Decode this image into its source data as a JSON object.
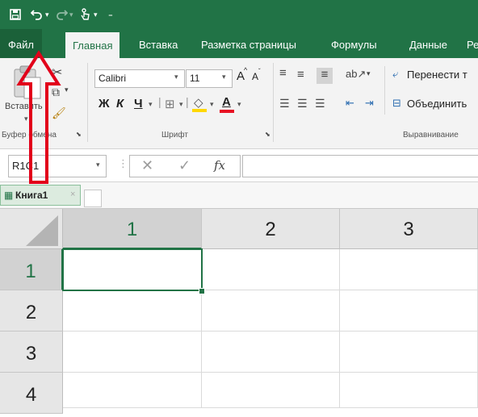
{
  "window": {
    "qat": {
      "save_icon": "save-icon",
      "undo_icon": "undo-icon",
      "redo_icon": "redo-icon",
      "touch_icon": "touch-mode-icon",
      "customize_icon": "customize-qat-icon"
    },
    "tabs": [
      {
        "label": "Файл"
      },
      {
        "label": "Главная"
      },
      {
        "label": "Вставка"
      },
      {
        "label": "Разметка страницы"
      },
      {
        "label": "Формулы"
      },
      {
        "label": "Данные"
      },
      {
        "label": "Ре"
      }
    ]
  },
  "ribbon": {
    "clipboard": {
      "paste_label": "Вставить",
      "group_label": "Буфер обмена"
    },
    "font": {
      "font_name": "Calibri",
      "font_size": "11",
      "grow_label": "A",
      "shrink_label": "A",
      "bold_label": "Ж",
      "italic_label": "К",
      "underline_label": "Ч",
      "fill_label": "",
      "color_label": "A",
      "group_label": "Шрифт"
    },
    "alignment": {
      "wrap_label": "Перенести т",
      "merge_label": "Объединить",
      "group_label": "Выравнивание"
    },
    "colors": {
      "accent": "#217346",
      "highlight": "#ffd800",
      "font_color": "#e81123",
      "annotation_arrow": "#e2001a"
    }
  },
  "formula_bar": {
    "name_box": "R1C1",
    "fx_label": "fx",
    "value": ""
  },
  "sheet": {
    "workbook_tab": "Книга1",
    "close_label": "×",
    "columns": [
      "1",
      "2",
      "3"
    ],
    "rows": [
      "1",
      "2",
      "3",
      "4"
    ],
    "active_cell": "R1C1"
  }
}
